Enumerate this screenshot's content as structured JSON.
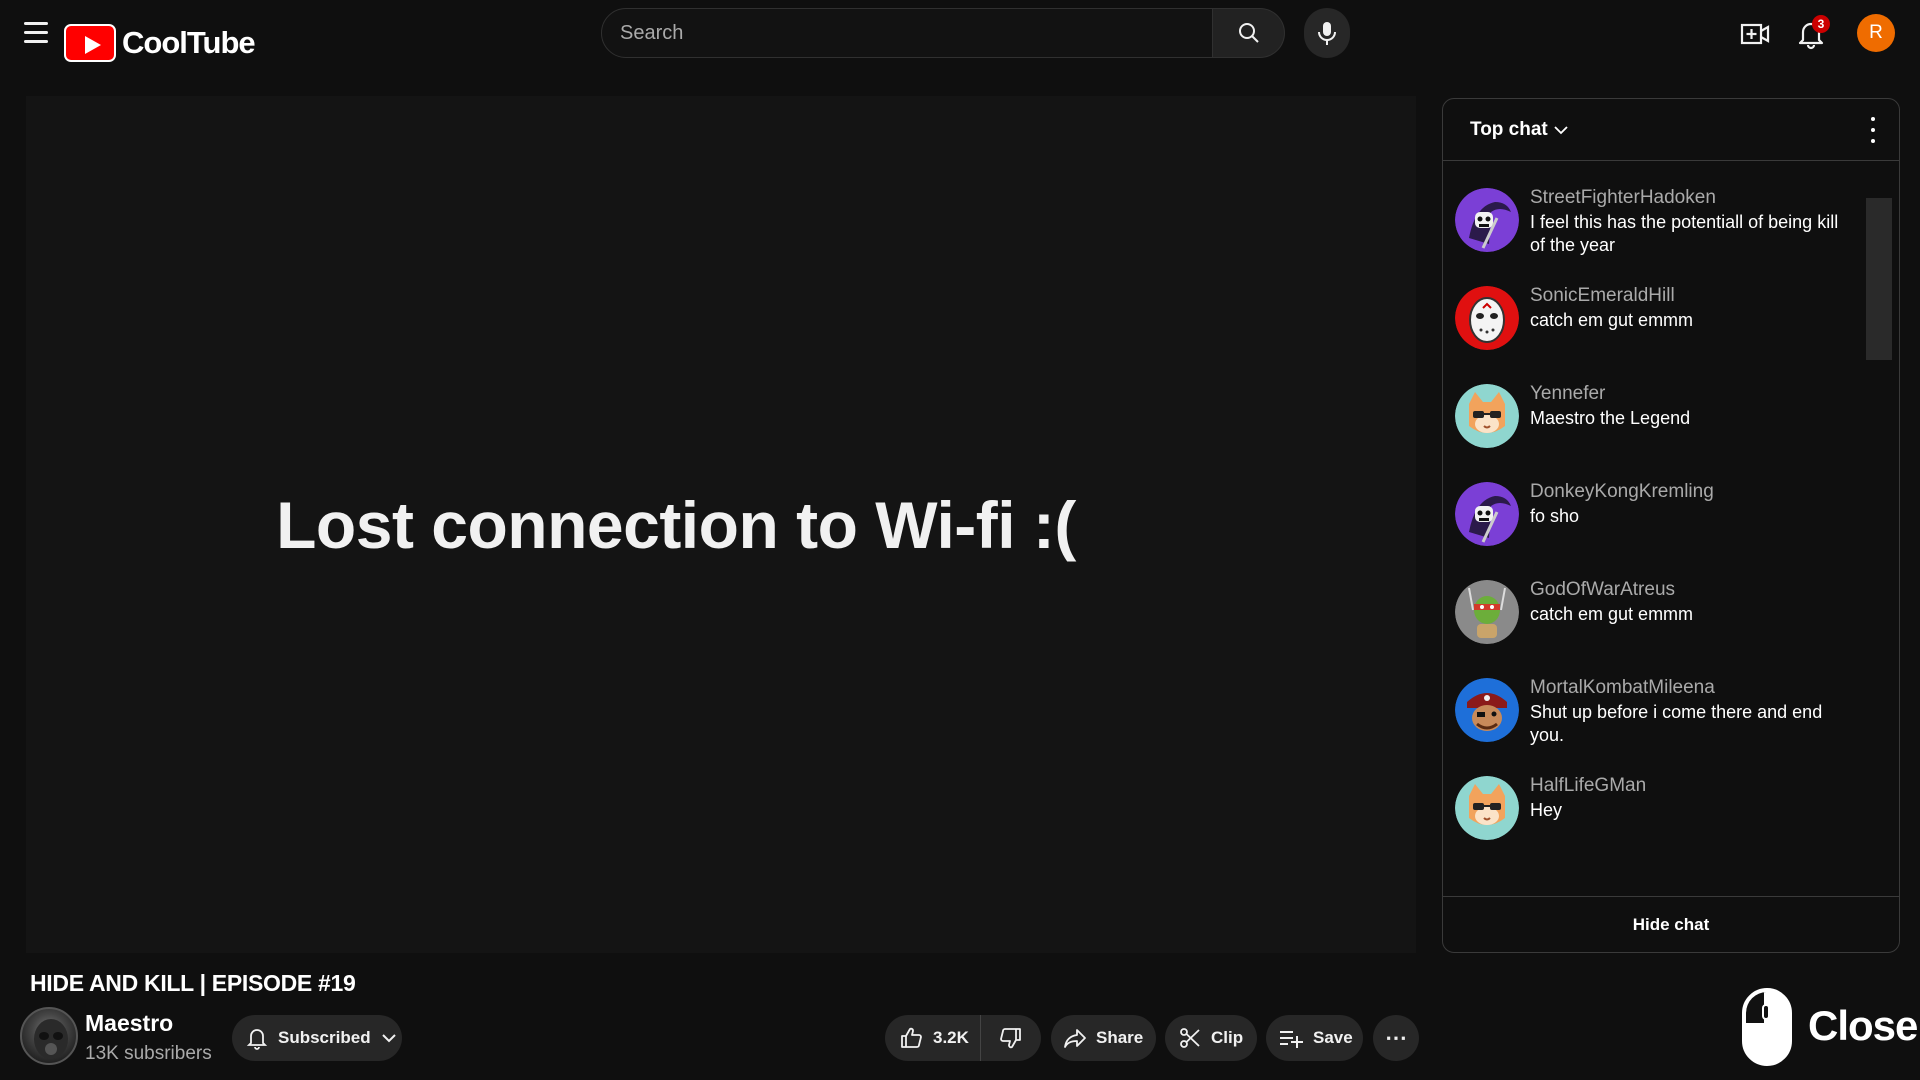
{
  "app": {
    "logo_text": "CoolTube"
  },
  "header": {
    "search_placeholder": "Search",
    "notification_count": "3",
    "user_initial": "R"
  },
  "player": {
    "message": "Lost connection to Wi-fi :("
  },
  "video": {
    "title": "HIDE AND KILL | EPISODE #19",
    "channel_name": "Maestro",
    "channel_subs": "13K subsribers",
    "subscribe_label": "Subscribed",
    "likes": "3.2K",
    "share_label": "Share",
    "clip_label": "Clip",
    "save_label": "Save"
  },
  "chat": {
    "mode": "Top chat",
    "hide_label": "Hide chat",
    "messages": [
      {
        "author": "StreetFighterHadoken",
        "text": "I feel this has the potentiall of being kill of the year",
        "avatar": "reaper",
        "color": "#7b3fd6"
      },
      {
        "author": "SonicEmeraldHill",
        "text": "catch em gut emmm",
        "avatar": "hockey-mask",
        "color": "#e01010"
      },
      {
        "author": "Yennefer",
        "text": "Maestro the Legend",
        "avatar": "cat",
        "color": "#8fd6cf"
      },
      {
        "author": "DonkeyKongKremling",
        "text": "fo sho",
        "avatar": "reaper",
        "color": "#7b3fd6"
      },
      {
        "author": "GodOfWarAtreus",
        "text": "catch em gut emmm",
        "avatar": "turtle",
        "color": "#8a8a8a"
      },
      {
        "author": "MortalKombatMileena",
        "text": "Shut up before i come there and end you.",
        "avatar": "pirate",
        "color": "#1e6fd9"
      },
      {
        "author": "HalfLifeGMan",
        "text": "Hey",
        "avatar": "cat",
        "color": "#8fd6cf"
      }
    ]
  },
  "overlay": {
    "close_label": "Close"
  }
}
